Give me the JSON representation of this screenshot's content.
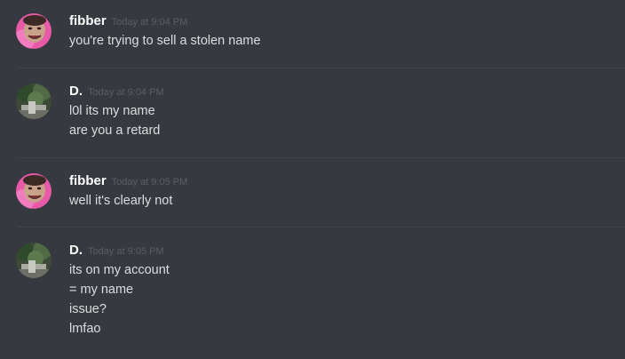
{
  "messages": [
    {
      "username": "fibber",
      "timestamp": "Today at 9:04 PM",
      "avatar": "pink-face-avatar",
      "lines": [
        "you're trying to sell a stolen name"
      ]
    },
    {
      "username": "D.",
      "timestamp": "Today at 9:04 PM",
      "avatar": "nature-photo-avatar",
      "lines": [
        "l0l its my name",
        "are you a retard"
      ]
    },
    {
      "username": "fibber",
      "timestamp": "Today at 9:05 PM",
      "avatar": "pink-face-avatar",
      "lines": [
        "well it's clearly not"
      ]
    },
    {
      "username": "D.",
      "timestamp": "Today at 9:05 PM",
      "avatar": "nature-photo-avatar",
      "lines": [
        "its on my account",
        "= my name",
        "issue?",
        "lmfao"
      ]
    }
  ],
  "colors": {
    "background": "#36393f",
    "username": "#ffffff",
    "timestamp": "#5b5e63",
    "message_text": "#dcddde",
    "divider": "#40434a"
  }
}
